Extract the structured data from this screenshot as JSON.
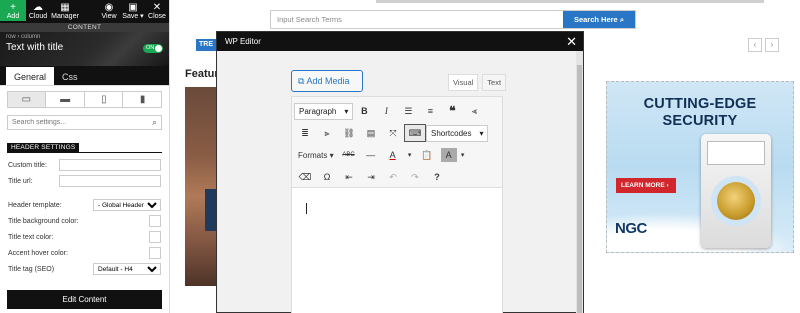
{
  "toolbar": {
    "add": "Add",
    "cloud": "Cloud",
    "manager": "Manager",
    "view": "View",
    "save": "Save ▾",
    "close": "Close"
  },
  "panel": {
    "section_bar": "CONTENT",
    "breadcrumb": "row  ›  column",
    "element_title": "Text with title",
    "toggle": "ON",
    "tabs": [
      "General",
      "Css"
    ],
    "search_placeholder": "Search settings...",
    "section_heading": "HEADER SETTINGS",
    "fields": {
      "custom_title": "Custom title:",
      "title_url": "Title url:",
      "header_template": "Header template:",
      "header_template_value": "- Global Header -",
      "title_bg_color": "Title background color:",
      "title_text_color": "Title text color:",
      "accent_hover_color": "Accent hover color:",
      "title_tag": "Title tag (SEO)",
      "title_tag_value": "Default - H4"
    },
    "edit_button": "Edit Content"
  },
  "site": {
    "search_placeholder": "Input Search Terms",
    "search_button": "Search Here",
    "trend_label": "TRE",
    "featured_label": "Featur",
    "ad": {
      "headline_1": "CUTTING-EDGE",
      "headline_2": "SECURITY",
      "cta": "LEARN MORE ›",
      "brand": "NGC"
    }
  },
  "editor": {
    "title": "WP Editor",
    "add_media": "Add Media",
    "mode_visual": "Visual",
    "mode_text": "Text",
    "paragraph": "Paragraph",
    "shortcodes": "Shortcodes",
    "formats": "Formats"
  },
  "colors": {
    "accent_green": "#1aa853",
    "link_blue": "#2a76c6",
    "panel_dark": "#111111",
    "ad_red": "#d0262c"
  }
}
